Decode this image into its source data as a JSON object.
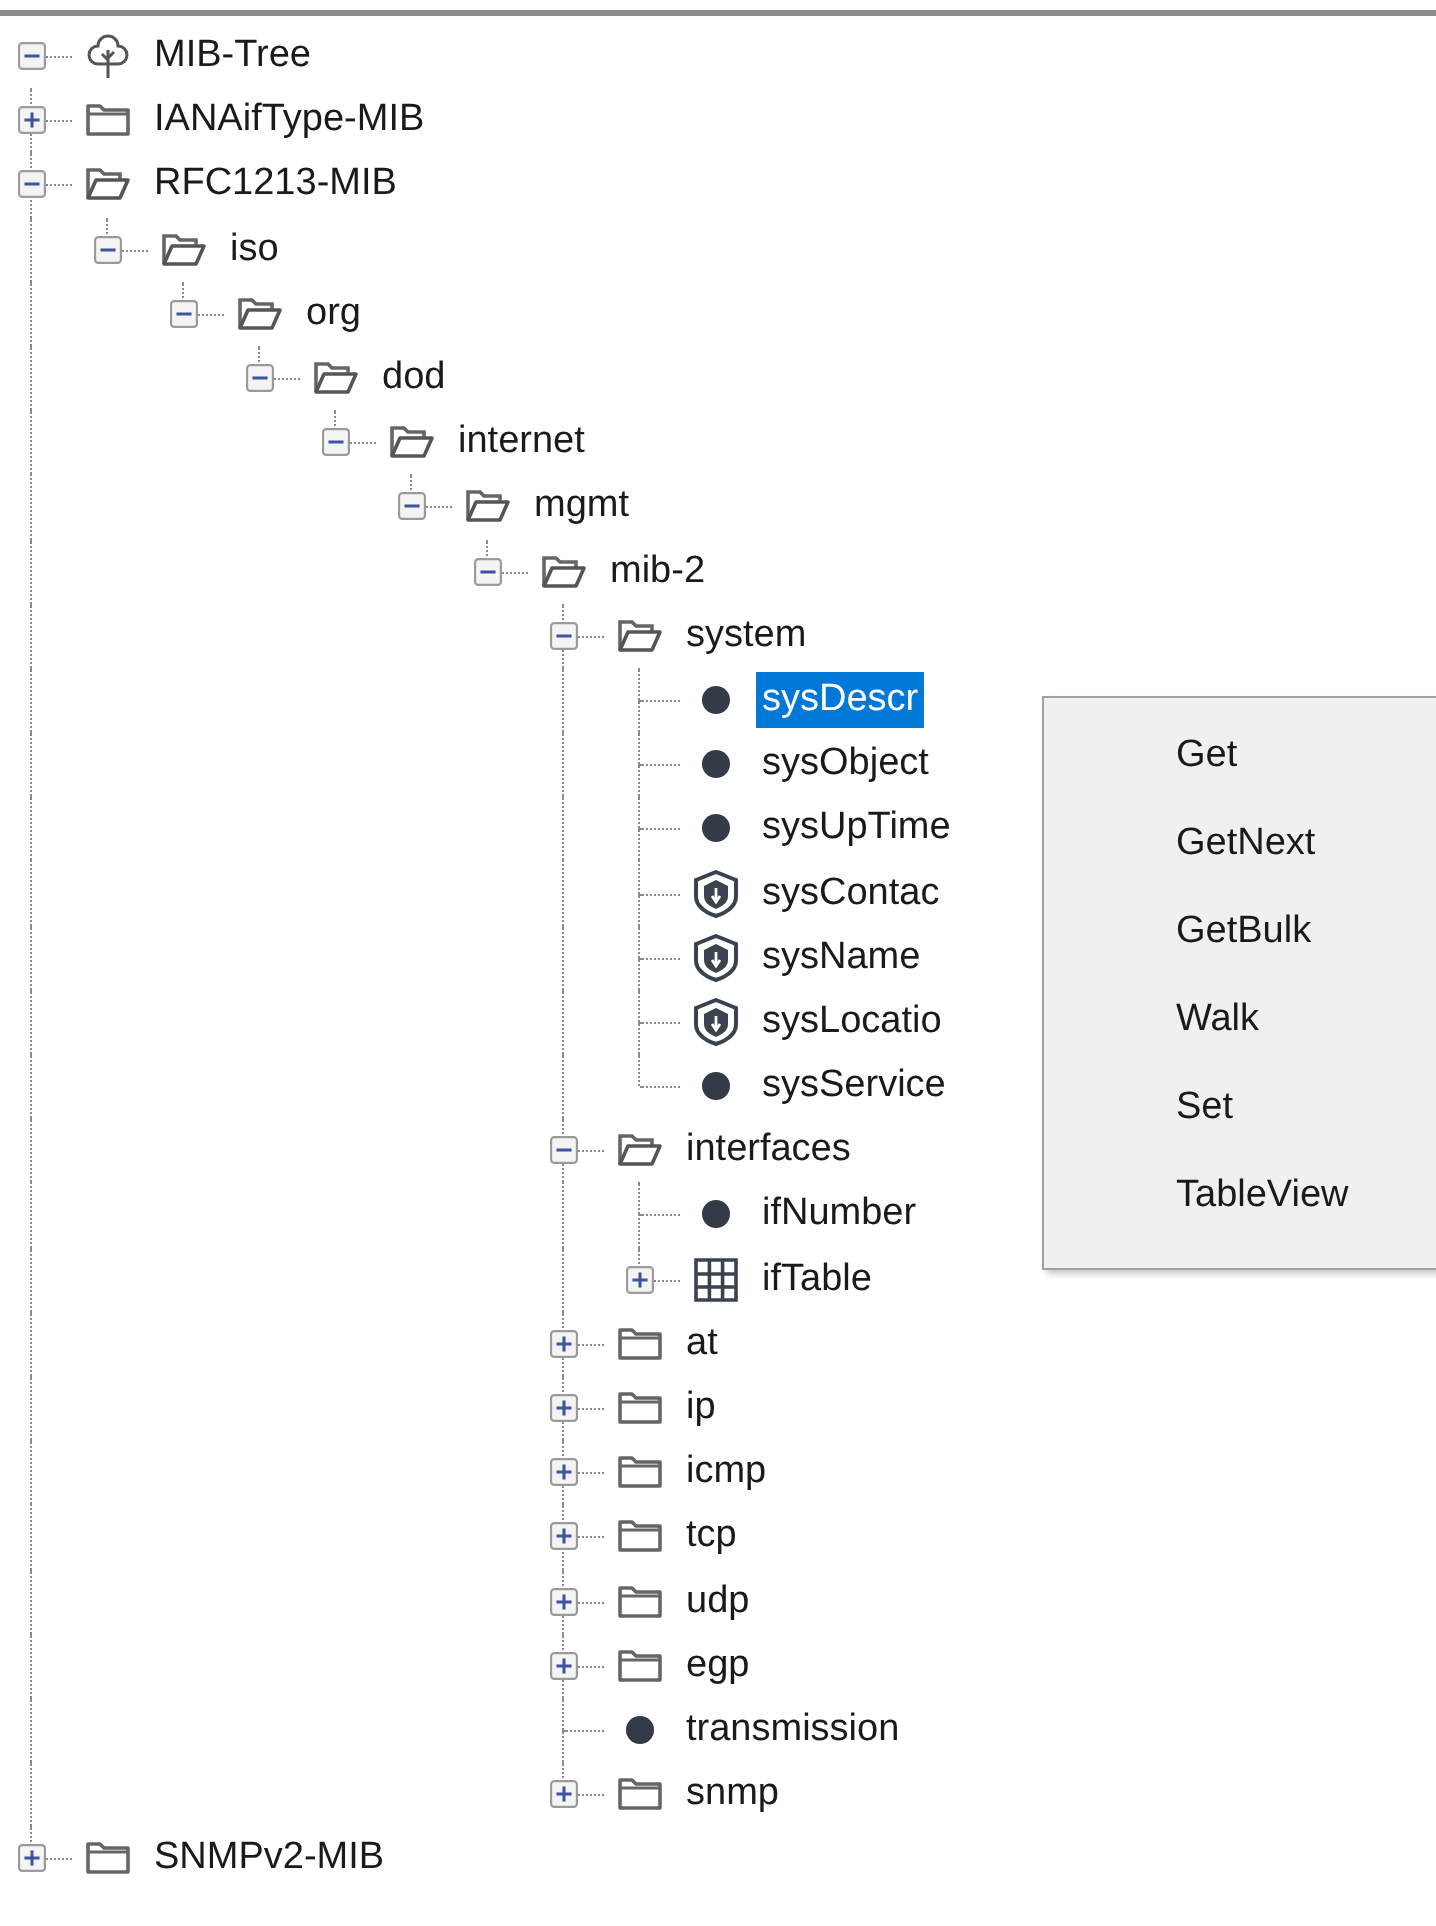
{
  "tree": {
    "label": "MIB-Tree",
    "kind": "root",
    "expanded": true,
    "children": [
      {
        "label": "IANAifType-MIB",
        "kind": "folder",
        "expanded": false
      },
      {
        "label": "RFC1213-MIB",
        "kind": "folder",
        "expanded": true,
        "children": [
          {
            "label": "iso",
            "kind": "folder",
            "expanded": true,
            "children": [
              {
                "label": "org",
                "kind": "folder",
                "expanded": true,
                "children": [
                  {
                    "label": "dod",
                    "kind": "folder",
                    "expanded": true,
                    "children": [
                      {
                        "label": "internet",
                        "kind": "folder",
                        "expanded": true,
                        "children": [
                          {
                            "label": "mgmt",
                            "kind": "folder",
                            "expanded": true,
                            "children": [
                              {
                                "label": "mib-2",
                                "kind": "folder",
                                "expanded": true,
                                "children": [
                                  {
                                    "label": "system",
                                    "kind": "folder",
                                    "expanded": true,
                                    "selected": false,
                                    "children": [
                                      {
                                        "label": "sysDescr",
                                        "kind": "scalar",
                                        "selected": true
                                      },
                                      {
                                        "label": "sysObject",
                                        "kind": "scalar",
                                        "selected": false
                                      },
                                      {
                                        "label": "sysUpTime",
                                        "kind": "scalar",
                                        "selected": false
                                      },
                                      {
                                        "label": "sysContac",
                                        "kind": "writable",
                                        "selected": false
                                      },
                                      {
                                        "label": "sysName",
                                        "kind": "writable",
                                        "selected": false
                                      },
                                      {
                                        "label": "sysLocatio",
                                        "kind": "writable",
                                        "selected": false
                                      },
                                      {
                                        "label": "sysService",
                                        "kind": "scalar",
                                        "selected": false
                                      }
                                    ]
                                  },
                                  {
                                    "label": "interfaces",
                                    "kind": "folder",
                                    "expanded": true,
                                    "children": [
                                      {
                                        "label": "ifNumber",
                                        "kind": "scalar"
                                      },
                                      {
                                        "label": "ifTable",
                                        "kind": "table",
                                        "expanded": false
                                      }
                                    ]
                                  },
                                  {
                                    "label": "at",
                                    "kind": "folder",
                                    "expanded": false
                                  },
                                  {
                                    "label": "ip",
                                    "kind": "folder",
                                    "expanded": false
                                  },
                                  {
                                    "label": "icmp",
                                    "kind": "folder",
                                    "expanded": false
                                  },
                                  {
                                    "label": "tcp",
                                    "kind": "folder",
                                    "expanded": false
                                  },
                                  {
                                    "label": "udp",
                                    "kind": "folder",
                                    "expanded": false
                                  },
                                  {
                                    "label": "egp",
                                    "kind": "folder",
                                    "expanded": false
                                  },
                                  {
                                    "label": "transmission",
                                    "kind": "scalar"
                                  },
                                  {
                                    "label": "snmp",
                                    "kind": "folder",
                                    "expanded": false
                                  }
                                ]
                              }
                            ]
                          }
                        ]
                      }
                    ]
                  }
                ]
              }
            ]
          }
        ]
      },
      {
        "label": "SNMPv2-MIB",
        "kind": "folder",
        "expanded": false
      }
    ]
  },
  "context_menu": {
    "items": [
      "Get",
      "GetNext",
      "GetBulk",
      "Walk",
      "Set",
      "TableView"
    ]
  }
}
